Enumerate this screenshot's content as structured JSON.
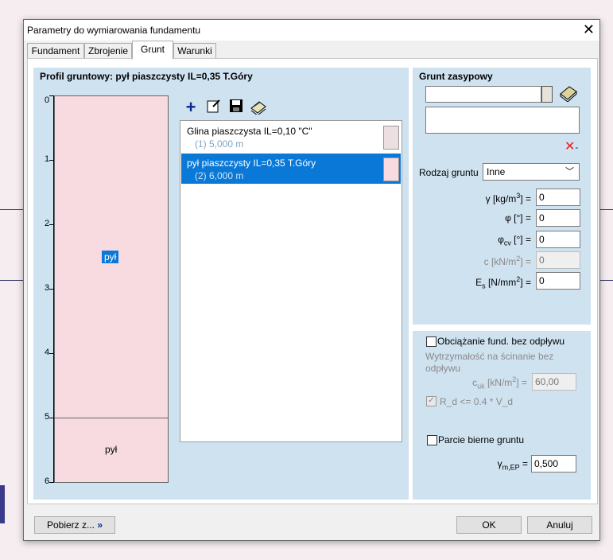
{
  "dialog": {
    "title": "Parametry do wymiarowania fundamentu",
    "close_glyph": "✕"
  },
  "tabs": [
    {
      "label": "Fundament"
    },
    {
      "label": "Zbrojenie"
    },
    {
      "label": "Grunt",
      "active": true
    },
    {
      "label": "Warunki"
    }
  ],
  "profile": {
    "title": "Profil gruntowy: pył piaszczysty IL=0,35 T.Góry",
    "ruler_ticks": [
      "0",
      "1",
      "2",
      "3",
      "4",
      "5",
      "6"
    ],
    "layers": [
      {
        "label": "pył",
        "from": 0,
        "to": 5,
        "selected": true
      },
      {
        "label": "pył",
        "from": 5,
        "to": 6,
        "selected": false
      }
    ]
  },
  "toolbar": {
    "add_icon": "plus-icon",
    "edit_icon": "edit-icon",
    "save_icon": "save-icon",
    "library_icon": "library-icon"
  },
  "layer_list": [
    {
      "name": "Glina piaszczysta IL=0,10 \"C\"",
      "sub": "(1) 5,000 m",
      "selected": false
    },
    {
      "name": "pył piaszczysty IL=0,35 T.Góry",
      "sub": "(2) 6,000 m",
      "selected": true
    }
  ],
  "backfill": {
    "title": "Grunt zasypowy",
    "field1_value": "",
    "field2_value": "",
    "soil_type_label": "Rodzaj gruntu",
    "soil_type_value": "Inne",
    "params": [
      {
        "label": "γ [kg/m³] =",
        "value": "0",
        "disabled": false
      },
      {
        "label": "φ [°] =",
        "value": "0",
        "disabled": false
      },
      {
        "label": "φcv [°] =",
        "value": "0",
        "disabled": false
      },
      {
        "label": "c [kN/m²] =",
        "value": "0",
        "disabled": true
      },
      {
        "label": "Es [N/mm²] =",
        "value": "0",
        "disabled": false
      }
    ]
  },
  "undrained": {
    "checkbox_label": "Obciążanie fund. bez odpływu",
    "strength_label": "Wytrzymałość na ścinanie bez odpływu",
    "cuk_label": "cuk [kN/m²] =",
    "cuk_value": "60,00",
    "rd_label": "R_d <= 0.4 * V_d"
  },
  "passive": {
    "checkbox_label": "Parcie bierne gruntu",
    "gamma_label": "γm,EP =",
    "gamma_value": "0,500"
  },
  "footer": {
    "fetch_label": "Pobierz z...",
    "fetch_icon": "double-chevron-right-icon",
    "ok_label": "OK",
    "cancel_label": "Anuluj"
  },
  "colors": {
    "panel_bg": "#cfe2f0",
    "selection": "#0a78d7",
    "soil_fill": "#f7dbe1",
    "delete_red": "#e02020",
    "add_blue": "#0c2a8a"
  }
}
